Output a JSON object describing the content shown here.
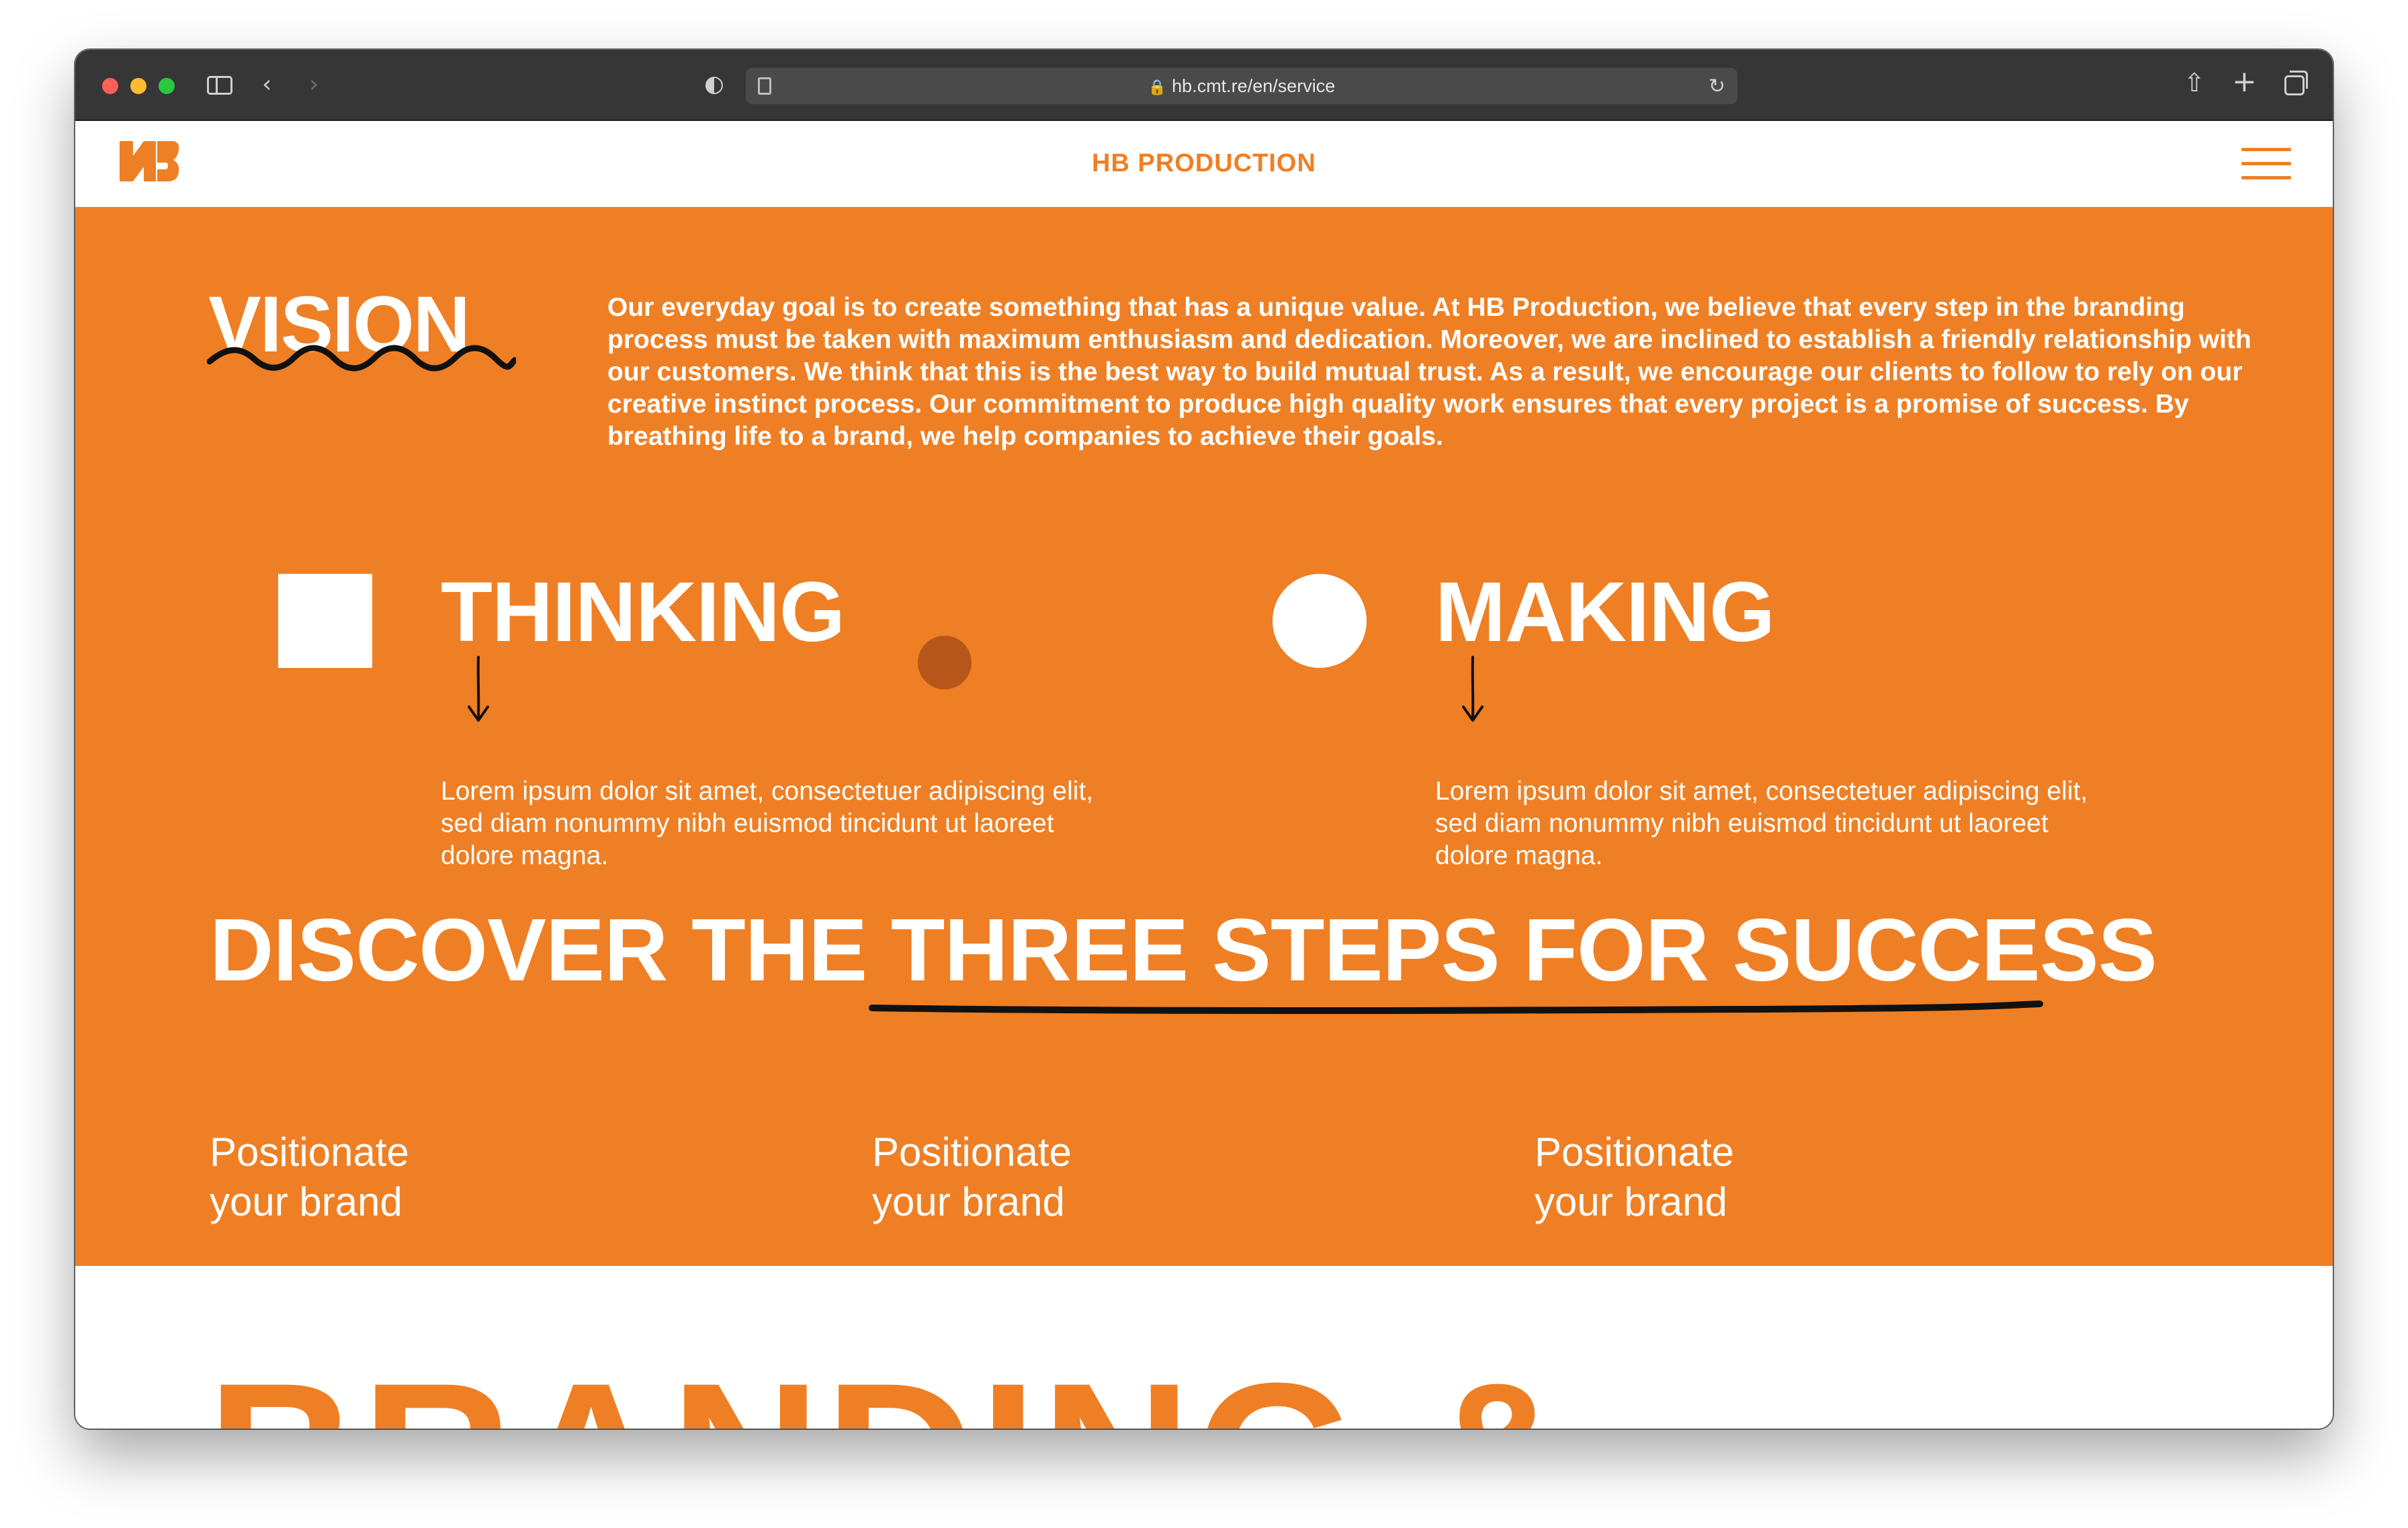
{
  "browser": {
    "url": "hb.cmt.re/en/service"
  },
  "header": {
    "logo_text": "HB",
    "title": "HB PRODUCTION"
  },
  "vision": {
    "title": "VISION",
    "text": "Our everyday goal is to create something that has a unique value. At HB Production, we believe that every step in the branding process must be taken with maximum enthusiasm and dedication. Moreover, we are inclined to establish a friendly relationship with our customers. We think that this is the best way to build mutual trust. As a result, we encourage our clients to follow to rely on our creative instinct process. Our commitment to produce high quality work ensures that every project is a promise of success. By breathing life to a brand, we help companies to achieve their goals."
  },
  "columns": [
    {
      "title": "THINKING",
      "text": "Lorem ipsum dolor sit amet, consectetuer adipiscing elit, sed diam nonummy nibh euismod tincidunt ut laoreet dolore magna."
    },
    {
      "title": "MAKING",
      "text": "Lorem ipsum dolor sit amet, consectetuer adipiscing elit, sed diam nonummy nibh euismod tincidunt ut laoreet dolore magna."
    }
  ],
  "discover": {
    "prefix": "DISCOVER THE ",
    "highlight": "THREE STEPS FOR SUCCESS"
  },
  "steps": [
    {
      "line1": "Positionate",
      "line2": "your brand"
    },
    {
      "line1": "Positionate",
      "line2": "your brand"
    },
    {
      "line1": "Positionate",
      "line2": "your brand"
    }
  ],
  "branding": {
    "title": "BRANDING &"
  },
  "colors": {
    "accent": "#ef7f24",
    "dot": "#b6561a",
    "chrome": "#363636"
  },
  "icons": {
    "sidebar": "sidebar-icon",
    "back": "chevron-left-icon",
    "forward": "chevron-right-icon",
    "shield": "shield-icon",
    "reader": "reader-icon",
    "lock": "lock-icon",
    "reload": "reload-icon",
    "share": "share-icon",
    "new_tab": "plus-icon",
    "tabs": "tabs-overview-icon",
    "menu": "hamburger-menu-icon"
  }
}
